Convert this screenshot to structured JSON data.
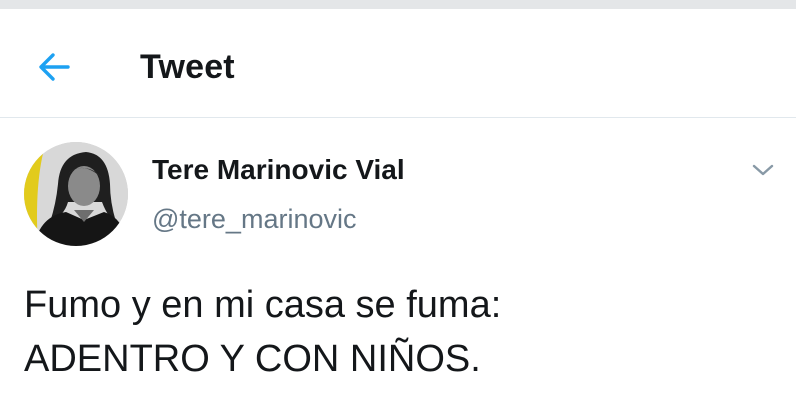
{
  "header": {
    "back_icon": "arrow-left-icon",
    "title": "Tweet"
  },
  "colors": {
    "accent": "#1da1f2",
    "text_primary": "#14171a",
    "text_secondary": "#657786",
    "divider": "#e1e8ed",
    "avatar_ring": "#e2cb1c"
  },
  "tweet": {
    "author": {
      "display_name": "Tere Marinovic Vial",
      "handle": "@tere_marinovic",
      "avatar_icon": "profile-photo"
    },
    "more_icon": "chevron-down-icon",
    "text_lines": [
      "Fumo y en mi casa se fuma:",
      "ADENTRO Y CON NIÑOS."
    ]
  }
}
